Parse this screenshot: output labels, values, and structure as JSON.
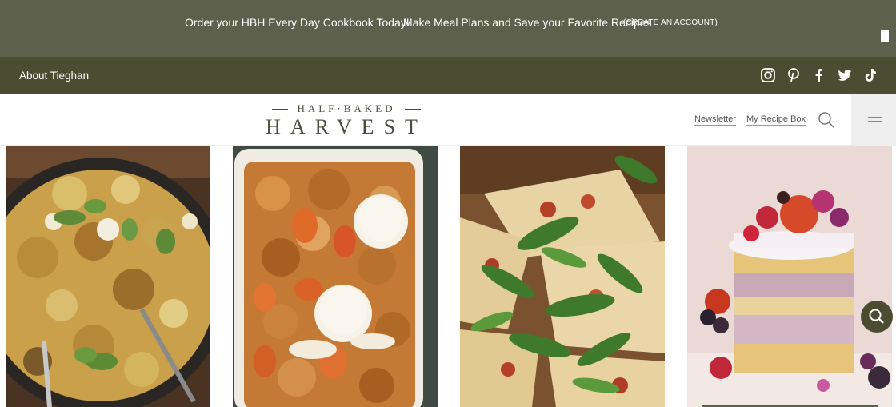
{
  "promo": {
    "link1": "Order your HBH Every Day Cookbook Today!",
    "link2": "Make Meal Plans and Save your Favorite Recipes",
    "cta": "(CREATE AN ACCOUNT)"
  },
  "subnav": {
    "about": "About Tieghan",
    "social": [
      "instagram-icon",
      "pinterest-icon",
      "facebook-icon",
      "twitter-icon",
      "tiktok-icon"
    ]
  },
  "header": {
    "logo_top": "HALF·BAKED",
    "logo_bottom": "HARVEST",
    "newsletter": "Newsletter",
    "recipe_box": "My Recipe Box"
  },
  "colors": {
    "promo_bg": "#5d604c",
    "subnav_bg": "#4b4d33",
    "logo": "#4b4d3e"
  },
  "cards": [
    {
      "image": "skillet-pasta-with-zucchini-and-basil"
    },
    {
      "image": "peach-cobbler-with-ice-cream"
    },
    {
      "image": "pizza-with-arugula"
    },
    {
      "image": "layered-cake-with-berries"
    }
  ]
}
